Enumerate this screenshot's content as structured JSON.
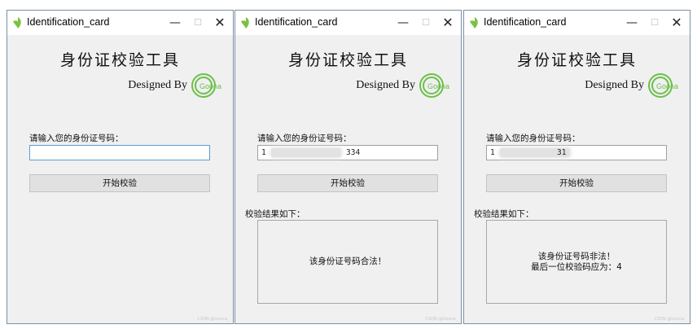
{
  "windows": [
    {
      "title": "Identification_card",
      "heading": "身份证校验工具",
      "designed_by": "Designed By",
      "logo_text": "Goona",
      "prompt": "请输入您的身份证号码：",
      "input_prefix": "",
      "input_suffix": "",
      "check_button": "开始校验",
      "result_label": "",
      "result_line1": "",
      "result_line2": "",
      "watermark": "CSDN @Goona_"
    },
    {
      "title": "Identification_card",
      "heading": "身份证校验工具",
      "designed_by": "Designed By",
      "logo_text": "Goona",
      "prompt": "请输入您的身份证号码：",
      "input_prefix": "1",
      "input_suffix": "334",
      "check_button": "开始校验",
      "result_label": "校验结果如下：",
      "result_line1": "该身份证号码合法！",
      "result_line2": "",
      "watermark": "CSDN @Goona_"
    },
    {
      "title": "Identification_card",
      "heading": "身份证校验工具",
      "designed_by": "Designed By",
      "logo_text": "Goona",
      "prompt": "请输入您的身份证号码：",
      "input_prefix": "1",
      "input_suffix": "31",
      "check_button": "开始校验",
      "result_label": "校验结果如下：",
      "result_line1": "该身份证号码非法！",
      "result_line2": "最后一位校验码应为：4",
      "watermark": "CSDN @Goona_"
    }
  ],
  "icons": {
    "app": "leaf-icon",
    "minimize": "minimize-icon",
    "maximize": "maximize-icon",
    "close": "close-icon"
  },
  "colors": {
    "logo_green": "#6cc04a",
    "focus_border": "#5a9bd8",
    "window_bg": "#f0f0f0"
  }
}
